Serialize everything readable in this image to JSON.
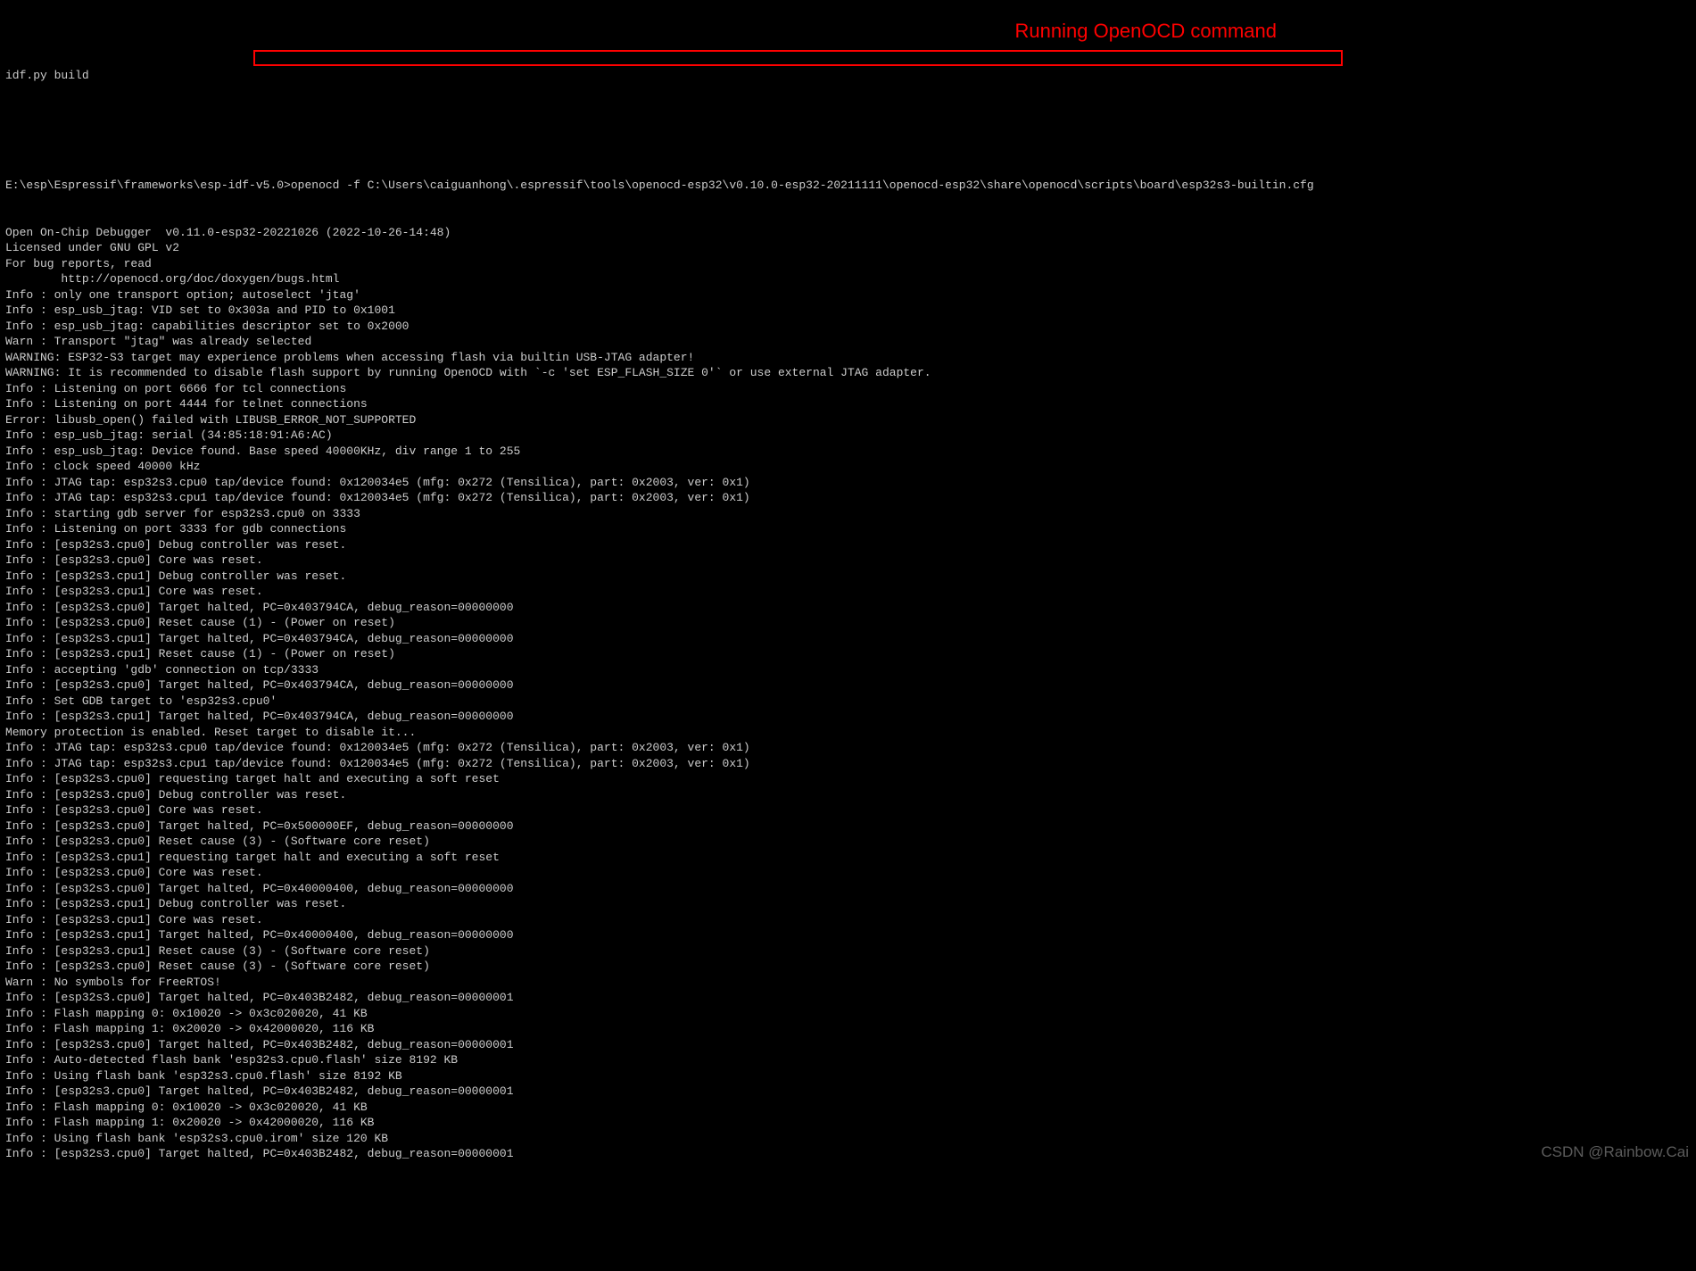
{
  "title": "idf.py build",
  "annotation": "Running OpenOCD command",
  "prompt_path": "E:\\esp\\Espressif\\frameworks\\esp-idf-v5.0>",
  "highlighted_command": "openocd -f C:\\Users\\caiguanhong\\.espressif\\tools\\openocd-esp32\\v0.10.0-esp32-20211111\\openocd-esp32\\share\\openocd\\scripts\\board\\esp32s3-builtin.cfg",
  "lines": [
    "Open On-Chip Debugger  v0.11.0-esp32-20221026 (2022-10-26-14:48)",
    "Licensed under GNU GPL v2",
    "For bug reports, read",
    "        http://openocd.org/doc/doxygen/bugs.html",
    "Info : only one transport option; autoselect 'jtag'",
    "Info : esp_usb_jtag: VID set to 0x303a and PID to 0x1001",
    "Info : esp_usb_jtag: capabilities descriptor set to 0x2000",
    "Warn : Transport \"jtag\" was already selected",
    "WARNING: ESP32-S3 target may experience problems when accessing flash via builtin USB-JTAG adapter!",
    "WARNING: It is recommended to disable flash support by running OpenOCD with `-c 'set ESP_FLASH_SIZE 0'` or use external JTAG adapter.",
    "Info : Listening on port 6666 for tcl connections",
    "Info : Listening on port 4444 for telnet connections",
    "Error: libusb_open() failed with LIBUSB_ERROR_NOT_SUPPORTED",
    "Info : esp_usb_jtag: serial (34:85:18:91:A6:AC)",
    "Info : esp_usb_jtag: Device found. Base speed 40000KHz, div range 1 to 255",
    "Info : clock speed 40000 kHz",
    "Info : JTAG tap: esp32s3.cpu0 tap/device found: 0x120034e5 (mfg: 0x272 (Tensilica), part: 0x2003, ver: 0x1)",
    "Info : JTAG tap: esp32s3.cpu1 tap/device found: 0x120034e5 (mfg: 0x272 (Tensilica), part: 0x2003, ver: 0x1)",
    "Info : starting gdb server for esp32s3.cpu0 on 3333",
    "Info : Listening on port 3333 for gdb connections",
    "Info : [esp32s3.cpu0] Debug controller was reset.",
    "Info : [esp32s3.cpu0] Core was reset.",
    "Info : [esp32s3.cpu1] Debug controller was reset.",
    "Info : [esp32s3.cpu1] Core was reset.",
    "Info : [esp32s3.cpu0] Target halted, PC=0x403794CA, debug_reason=00000000",
    "Info : [esp32s3.cpu0] Reset cause (1) - (Power on reset)",
    "Info : [esp32s3.cpu1] Target halted, PC=0x403794CA, debug_reason=00000000",
    "Info : [esp32s3.cpu1] Reset cause (1) - (Power on reset)",
    "Info : accepting 'gdb' connection on tcp/3333",
    "Info : [esp32s3.cpu0] Target halted, PC=0x403794CA, debug_reason=00000000",
    "Info : Set GDB target to 'esp32s3.cpu0'",
    "Info : [esp32s3.cpu1] Target halted, PC=0x403794CA, debug_reason=00000000",
    "Memory protection is enabled. Reset target to disable it...",
    "Info : JTAG tap: esp32s3.cpu0 tap/device found: 0x120034e5 (mfg: 0x272 (Tensilica), part: 0x2003, ver: 0x1)",
    "Info : JTAG tap: esp32s3.cpu1 tap/device found: 0x120034e5 (mfg: 0x272 (Tensilica), part: 0x2003, ver: 0x1)",
    "Info : [esp32s3.cpu0] requesting target halt and executing a soft reset",
    "Info : [esp32s3.cpu0] Debug controller was reset.",
    "Info : [esp32s3.cpu0] Core was reset.",
    "Info : [esp32s3.cpu0] Target halted, PC=0x500000EF, debug_reason=00000000",
    "Info : [esp32s3.cpu0] Reset cause (3) - (Software core reset)",
    "Info : [esp32s3.cpu1] requesting target halt and executing a soft reset",
    "Info : [esp32s3.cpu0] Core was reset.",
    "Info : [esp32s3.cpu0] Target halted, PC=0x40000400, debug_reason=00000000",
    "Info : [esp32s3.cpu1] Debug controller was reset.",
    "Info : [esp32s3.cpu1] Core was reset.",
    "Info : [esp32s3.cpu1] Target halted, PC=0x40000400, debug_reason=00000000",
    "Info : [esp32s3.cpu1] Reset cause (3) - (Software core reset)",
    "Info : [esp32s3.cpu0] Reset cause (3) - (Software core reset)",
    "Warn : No symbols for FreeRTOS!",
    "Info : [esp32s3.cpu0] Target halted, PC=0x403B2482, debug_reason=00000001",
    "Info : Flash mapping 0: 0x10020 -> 0x3c020020, 41 KB",
    "Info : Flash mapping 1: 0x20020 -> 0x42000020, 116 KB",
    "Info : [esp32s3.cpu0] Target halted, PC=0x403B2482, debug_reason=00000001",
    "Info : Auto-detected flash bank 'esp32s3.cpu0.flash' size 8192 KB",
    "Info : Using flash bank 'esp32s3.cpu0.flash' size 8192 KB",
    "Info : [esp32s3.cpu0] Target halted, PC=0x403B2482, debug_reason=00000001",
    "Info : Flash mapping 0: 0x10020 -> 0x3c020020, 41 KB",
    "Info : Flash mapping 1: 0x20020 -> 0x42000020, 116 KB",
    "Info : Using flash bank 'esp32s3.cpu0.irom' size 120 KB",
    "Info : [esp32s3.cpu0] Target halted, PC=0x403B2482, debug_reason=00000001"
  ],
  "watermark": "CSDN @Rainbow.Cai"
}
